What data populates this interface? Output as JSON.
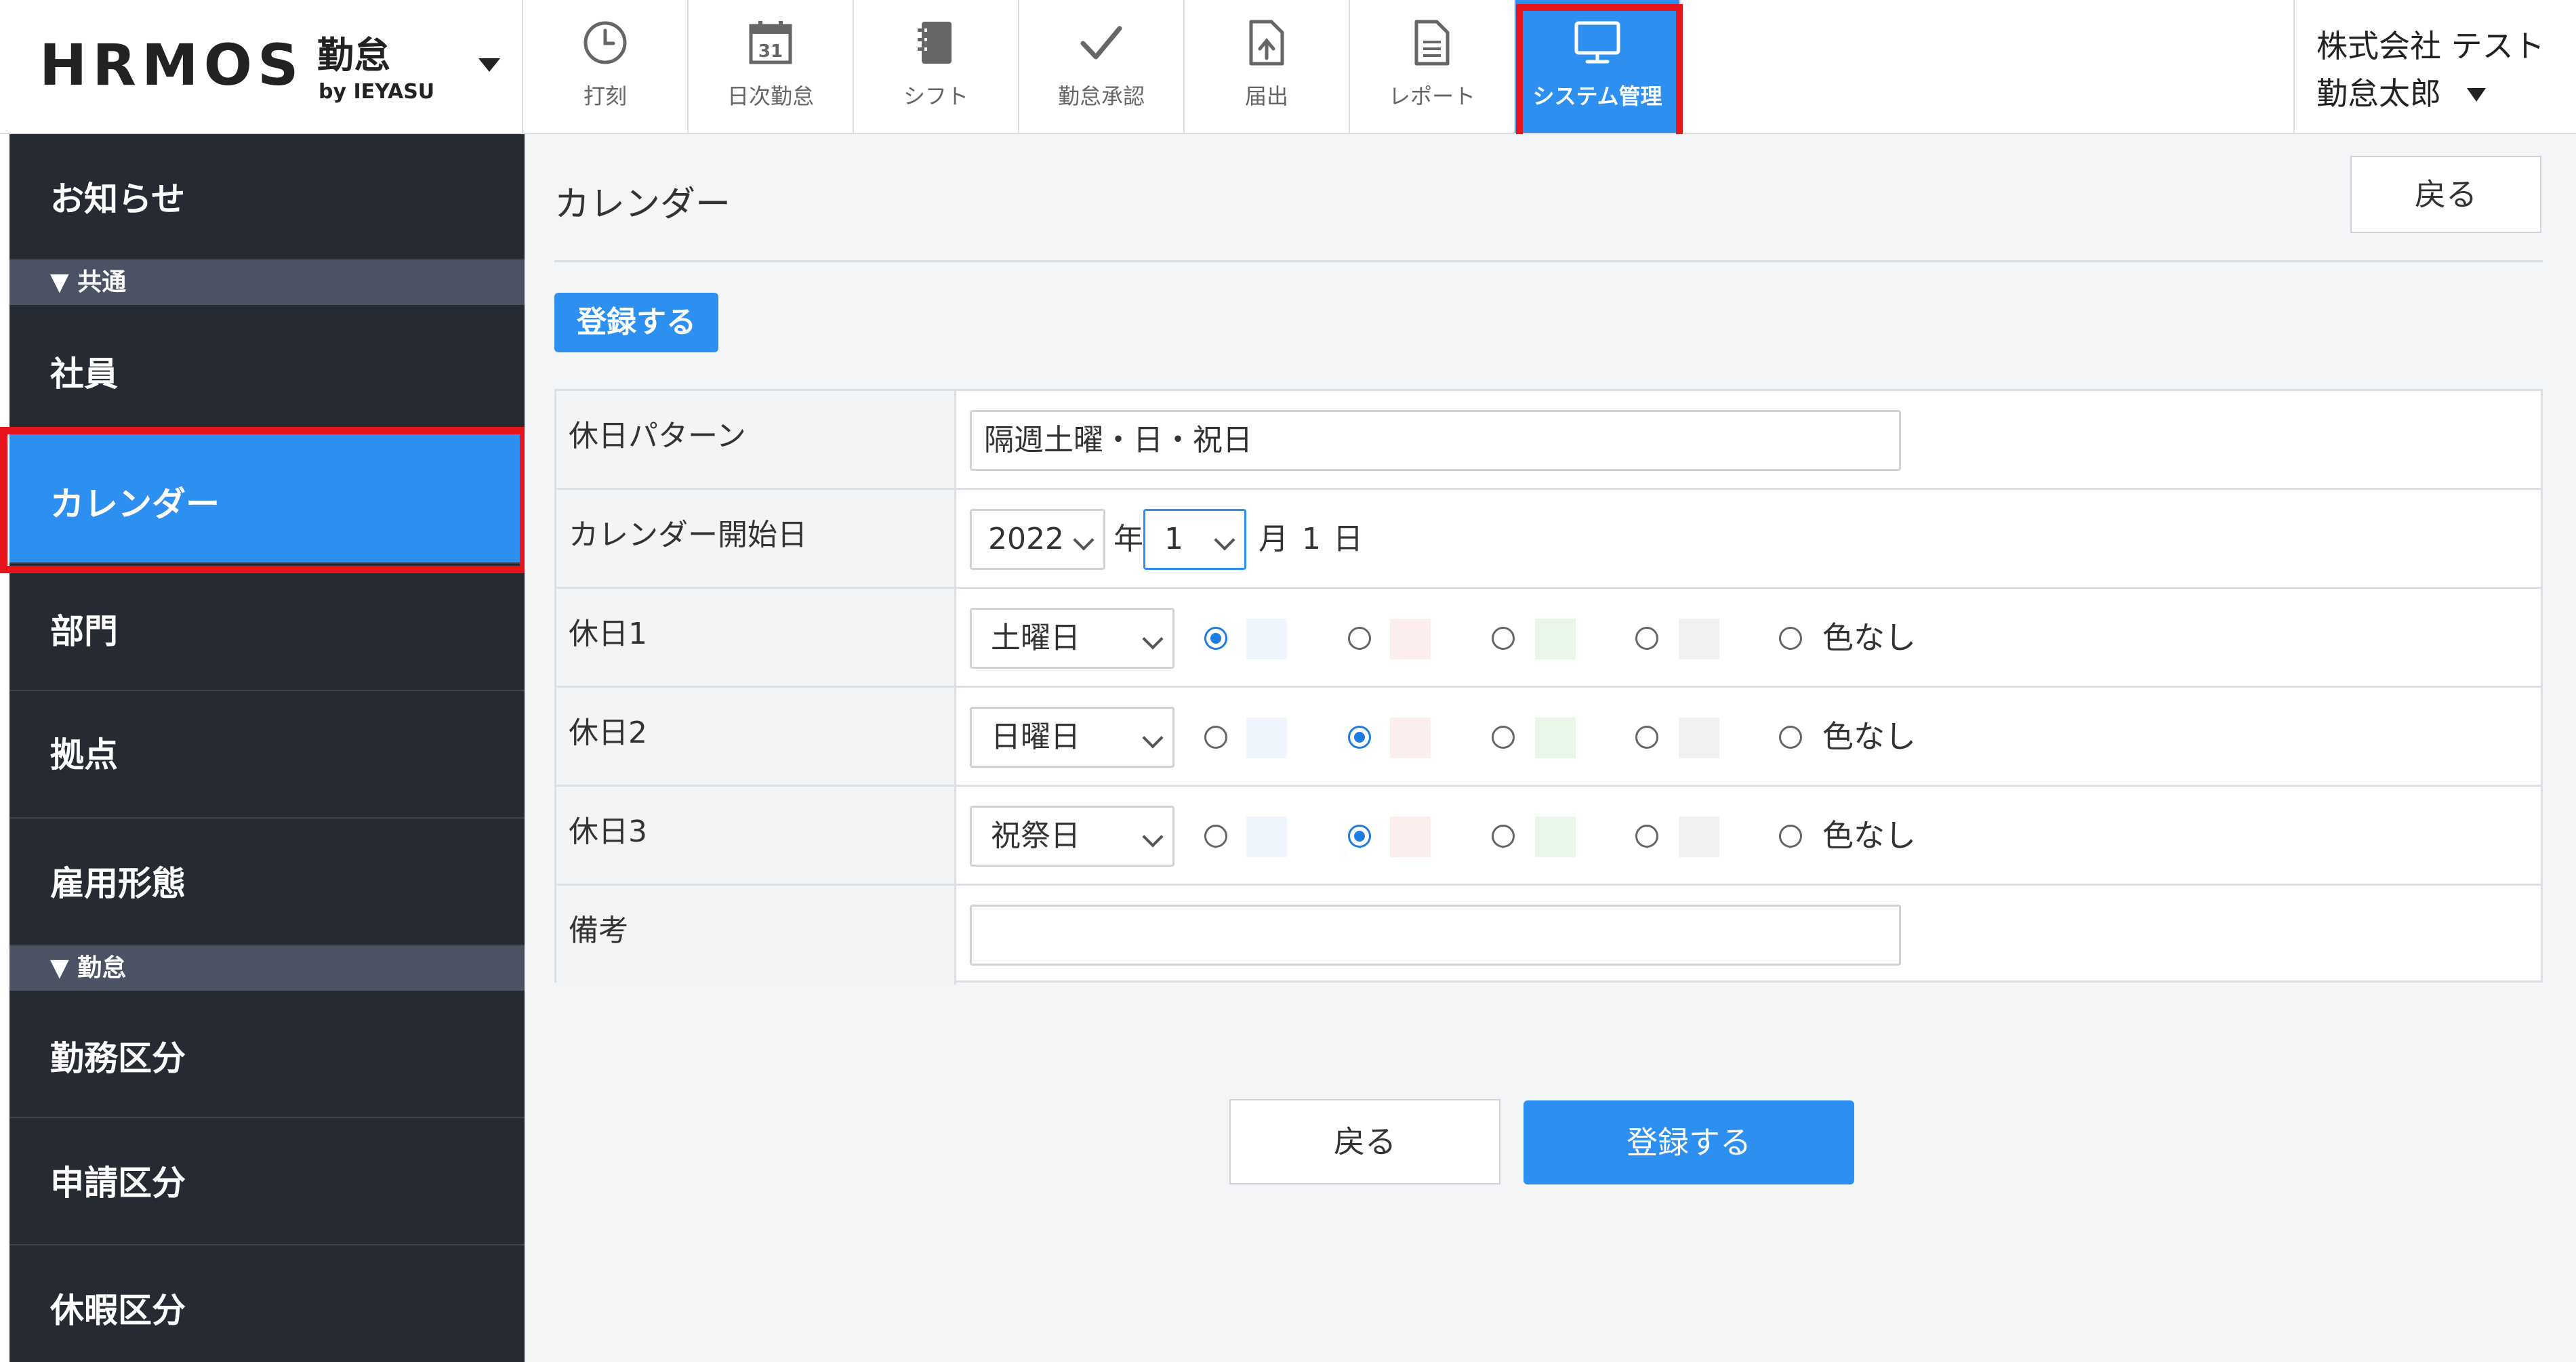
{
  "header": {
    "logo_word": "HRMOS",
    "logo_kanji": "勤怠",
    "logo_sub": "by IEYASU",
    "nav": [
      {
        "label": "打刻",
        "icon": "clock-icon"
      },
      {
        "label": "日次勤怠",
        "icon": "calendar-31-icon"
      },
      {
        "label": "シフト",
        "icon": "notebook-icon"
      },
      {
        "label": "勤怠承認",
        "icon": "checkmark-icon"
      },
      {
        "label": "届出",
        "icon": "file-upload-icon"
      },
      {
        "label": "レポート",
        "icon": "document-icon"
      },
      {
        "label": "システム管理",
        "icon": "monitor-icon",
        "active": true
      }
    ],
    "user": {
      "company": "株式会社 テスト",
      "name": "勤怠太郎"
    }
  },
  "sidebar": {
    "items": [
      {
        "label": "お知らせ"
      },
      {
        "section": "▼ 共通"
      },
      {
        "label": "社員"
      },
      {
        "label": "カレンダー",
        "active": true
      },
      {
        "label": "部門"
      },
      {
        "label": "拠点"
      },
      {
        "label": "雇用形態"
      },
      {
        "section": "▼ 勤怠"
      },
      {
        "label": "勤務区分"
      },
      {
        "label": "申請区分"
      },
      {
        "label": "休暇区分"
      }
    ]
  },
  "main": {
    "title": "カレンダー",
    "back_label": "戻る",
    "register_label": "登録する",
    "form": {
      "holiday_pattern": {
        "label": "休日パターン",
        "value": "隔週土曜・日・祝日"
      },
      "start_date": {
        "label": "カレンダー開始日",
        "year": "2022",
        "year_unit": "年",
        "month": "1",
        "month_unit": "月",
        "day": "1",
        "day_unit": "日"
      },
      "holidays": [
        {
          "label": "休日1",
          "day": "土曜日",
          "selected": 0
        },
        {
          "label": "休日2",
          "day": "日曜日",
          "selected": 1
        },
        {
          "label": "休日3",
          "day": "祝祭日",
          "selected": 1
        }
      ],
      "color_options": [
        "#eef5fd",
        "#fdeeee",
        "#e9f7e9",
        "#f1f1f1"
      ],
      "no_color_label": "色なし",
      "remarks": {
        "label": "備考",
        "value": ""
      }
    }
  },
  "colors": {
    "accent": "#2d8ff0",
    "sidebar_bg": "#252a33",
    "highlight": "#e8141c"
  }
}
